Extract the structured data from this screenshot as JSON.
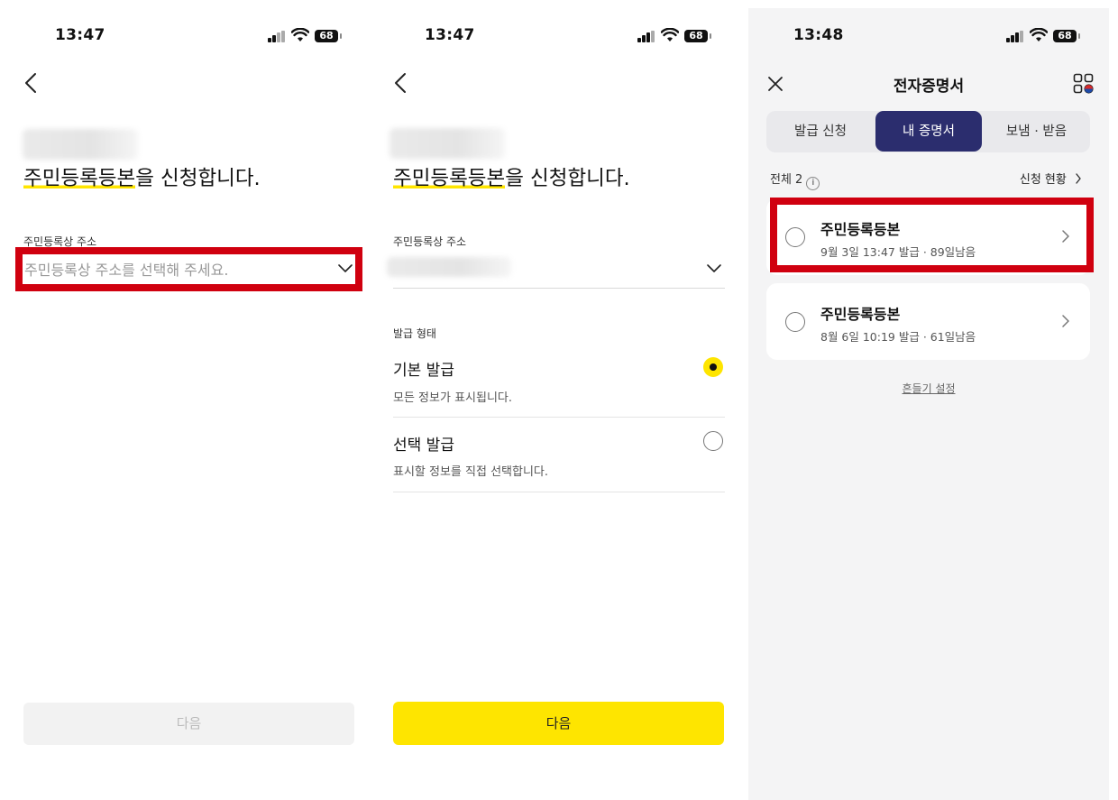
{
  "screen1": {
    "time": "13:47",
    "battery": "68",
    "headline_highlight": "주민등록등본",
    "headline_rest": "을 신청합니다.",
    "address_label": "주민등록상 주소",
    "address_placeholder": "주민등록상 주소를 선택해 주세요.",
    "next_button": "다음"
  },
  "screen2": {
    "time": "13:47",
    "battery": "68",
    "headline_highlight": "주민등록등본",
    "headline_rest": "을 신청합니다.",
    "address_label": "주민등록상 주소",
    "issue_type_label": "발급 형태",
    "options": [
      {
        "title": "기본 발급",
        "desc": "모든 정보가 표시됩니다.",
        "selected": true
      },
      {
        "title": "선택 발급",
        "desc": "표시할 정보를 직접 선택합니다.",
        "selected": false
      }
    ],
    "next_button": "다음"
  },
  "screen3": {
    "time": "13:48",
    "battery": "68",
    "title": "전자증명서",
    "tabs": [
      {
        "label": "발급 신청",
        "active": false
      },
      {
        "label": "내 증명서",
        "active": true
      },
      {
        "label": "보냄 · 받음",
        "active": false
      }
    ],
    "total_count": "전체 2",
    "status_link": "신청 현황",
    "certificates": [
      {
        "title": "주민등록등본",
        "subtitle": "9월 3일 13:47 발급 · 89일남음"
      },
      {
        "title": "주민등록등본",
        "subtitle": "8월 6일 10:19 발급 · 61일남음"
      }
    ],
    "shake_setting": "흔들기 설정"
  },
  "colors": {
    "highlight_red": "#d0000f",
    "kakao_yellow": "#fee500",
    "tab_active": "#2b2d6e"
  }
}
